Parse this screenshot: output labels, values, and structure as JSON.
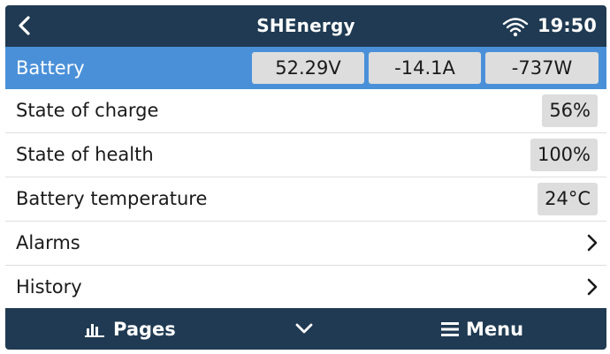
{
  "header": {
    "title": "SHEnergy",
    "clock": "19:50",
    "back_icon": "chevron-left-icon",
    "wifi_icon": "wifi-icon"
  },
  "battery": {
    "label": "Battery",
    "voltage": "52.29V",
    "current": "-14.1A",
    "power": "-737W"
  },
  "rows": [
    {
      "label": "State of charge",
      "value": "56%"
    },
    {
      "label": "State of health",
      "value": "100%"
    },
    {
      "label": "Battery temperature",
      "value": "24°C"
    },
    {
      "label": "Alarms",
      "icon": "chevron-right-icon"
    },
    {
      "label": "History",
      "icon": "chevron-right-icon"
    }
  ],
  "footer": {
    "pages_label": "Pages",
    "menu_label": "Menu",
    "pages_icon": "bar-chart-icon",
    "down_icon": "chevron-down-icon",
    "menu_icon": "hamburger-icon"
  },
  "colors": {
    "header_bg": "#1f3a52",
    "selected_row_bg": "#4a90d9",
    "value_box_bg": "#dddddd"
  }
}
